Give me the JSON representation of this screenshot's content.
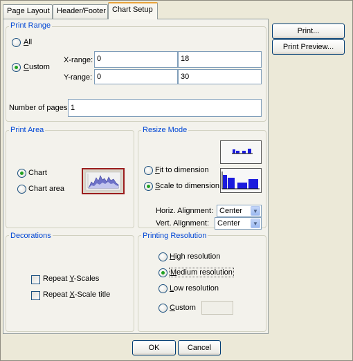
{
  "tabs": [
    "Page Layout",
    "Header/Footer",
    "Chart Setup"
  ],
  "print_range": {
    "title": "Print Range",
    "all_label": "All",
    "custom_label": "Custom",
    "x_range_label": "X-range:",
    "y_range_label": "Y-range:",
    "x_from": "0",
    "x_to": "18",
    "y_from": "0",
    "y_to": "30",
    "pages_label": "Number of pages:",
    "pages_value": "1",
    "selected": "custom"
  },
  "print_area": {
    "title": "Print Area",
    "chart_label": "Chart",
    "chart_area_label": "Chart area",
    "selected": "chart"
  },
  "resize_mode": {
    "title": "Resize Mode",
    "fit_label": "Fit to dimension",
    "scale_label": "Scale to dimension",
    "selected": "scale",
    "horiz_label": "Horiz. Alignment:",
    "horiz_value": "Center",
    "vert_label": "Vert. Alignment:",
    "vert_value": "Center"
  },
  "decorations": {
    "title": "Decorations",
    "repeat_y": "Repeat Y-Scales",
    "repeat_x": "Repeat X-Scale title",
    "repeat_y_checked": false,
    "repeat_x_checked": false
  },
  "printing_resolution": {
    "title": "Printing Resolution",
    "high": "High resolution",
    "medium": "Medium resolution",
    "low": "Low resolution",
    "custom": "Custom",
    "selected": "medium",
    "custom_value": ""
  },
  "side_buttons": {
    "print": "Print...",
    "print_preview": "Print Preview..."
  },
  "footer": {
    "ok": "OK",
    "cancel": "Cancel"
  },
  "colors": {
    "accent": "#0046d5",
    "radio_dot": "#21a121",
    "preview_bar": "#1a1add"
  }
}
